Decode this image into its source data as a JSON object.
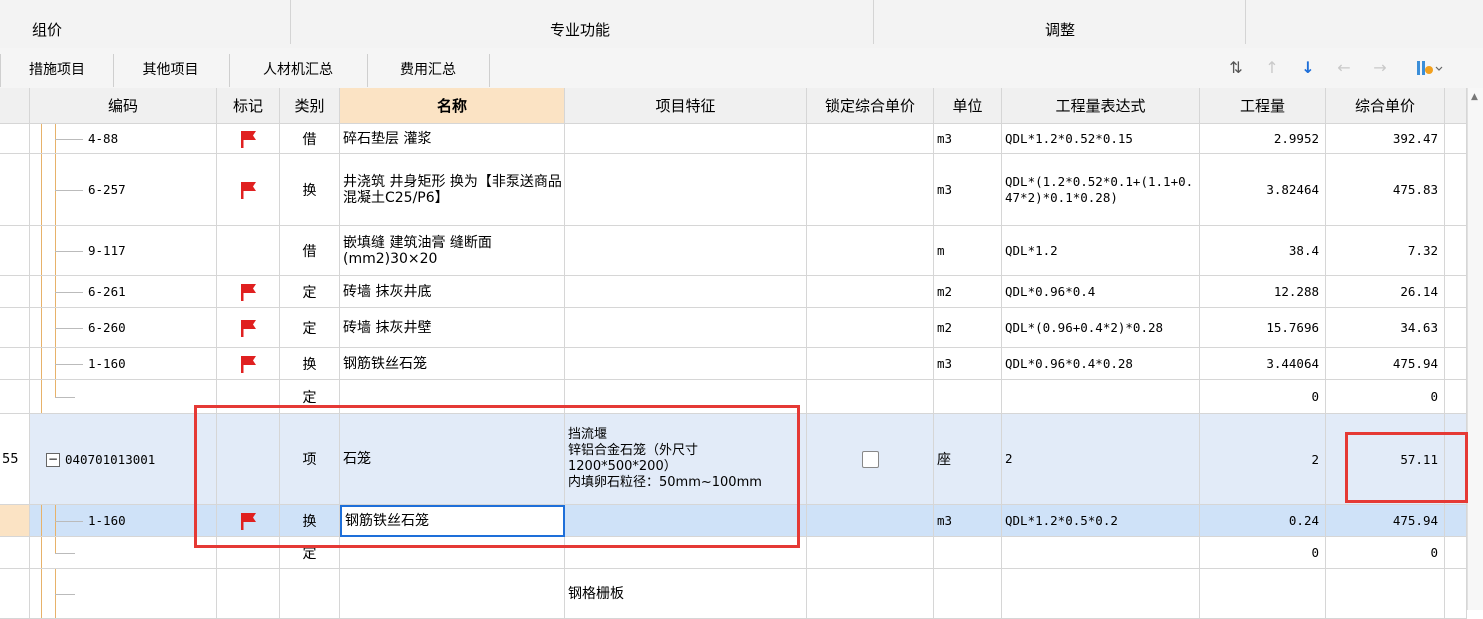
{
  "ribbon": {
    "groups": [
      "组价",
      "专业功能",
      "调整"
    ]
  },
  "tabs": [
    "措施项目",
    "其他项目",
    "人材机汇总",
    "费用汇总"
  ],
  "columns": [
    "编码",
    "标记",
    "类别",
    "名称",
    "项目特征",
    "锁定综合单价",
    "单位",
    "工程量表达式",
    "工程量",
    "综合单价"
  ],
  "rows": [
    {
      "code": "4-88",
      "flag": true,
      "type": "借",
      "name": "碎石垫层 灌浆",
      "feature": "",
      "unit": "m3",
      "expr": "QDL*1.2*0.52*0.15",
      "qty": "2.9952",
      "price": "392.47"
    },
    {
      "code": "6-257",
      "flag": true,
      "type": "换",
      "name": "井浇筑 井身矩形 换为【非泵送商品混凝土C25/P6】",
      "feature": "",
      "unit": "m3",
      "expr": "QDL*(1.2*0.52*0.1+(1.1+0.47*2)*0.1*0.28)",
      "qty": "3.82464",
      "price": "475.83"
    },
    {
      "code": "9-117",
      "flag": false,
      "type": "借",
      "name": "嵌填缝 建筑油膏 缝断面(mm2)30×20",
      "feature": "",
      "unit": "m",
      "expr": "QDL*1.2",
      "qty": "38.4",
      "price": "7.32"
    },
    {
      "code": "6-261",
      "flag": true,
      "type": "定",
      "name": "砖墙 抹灰井底",
      "feature": "",
      "unit": "m2",
      "expr": "QDL*0.96*0.4",
      "qty": "12.288",
      "price": "26.14"
    },
    {
      "code": "6-260",
      "flag": true,
      "type": "定",
      "name": "砖墙 抹灰井壁",
      "feature": "",
      "unit": "m2",
      "expr": "QDL*(0.96+0.4*2)*0.28",
      "qty": "15.7696",
      "price": "34.63"
    },
    {
      "code": "1-160",
      "flag": true,
      "type": "换",
      "name": "钢筋铁丝石笼",
      "feature": "",
      "unit": "m3",
      "expr": "QDL*0.96*0.4*0.28",
      "qty": "3.44064",
      "price": "475.94"
    },
    {
      "code": "",
      "flag": false,
      "type": "定",
      "name": "",
      "feature": "",
      "unit": "",
      "expr": "",
      "qty": "0",
      "price": "0"
    },
    {
      "rownum": "55",
      "code": "040701013001",
      "flag": false,
      "type": "项",
      "name": "石笼",
      "feature": "挡流堰\n锌铝合金石笼（外尺寸\n1200*500*200）\n内填卵石粒径：50mm~100mm",
      "unit": "座",
      "expr": "2",
      "qty": "2",
      "price": "57.11",
      "expand": "−"
    },
    {
      "code": "1-160",
      "flag": true,
      "type": "换",
      "name": "钢筋铁丝石笼",
      "feature": "",
      "unit": "m3",
      "expr": "QDL*1.2*0.5*0.2",
      "qty": "0.24",
      "price": "475.94"
    },
    {
      "code": "",
      "flag": false,
      "type": "定",
      "name": "",
      "feature": "",
      "unit": "",
      "expr": "",
      "qty": "0",
      "price": "0"
    },
    {
      "code": "",
      "flag": false,
      "type": "",
      "name": "",
      "feature": "钢格栅板",
      "unit": "",
      "expr": "",
      "qty": "",
      "price": ""
    }
  ],
  "colors": {
    "flag": "#e02020",
    "highlight": "#e53935",
    "selection": "#1e6fd9"
  }
}
